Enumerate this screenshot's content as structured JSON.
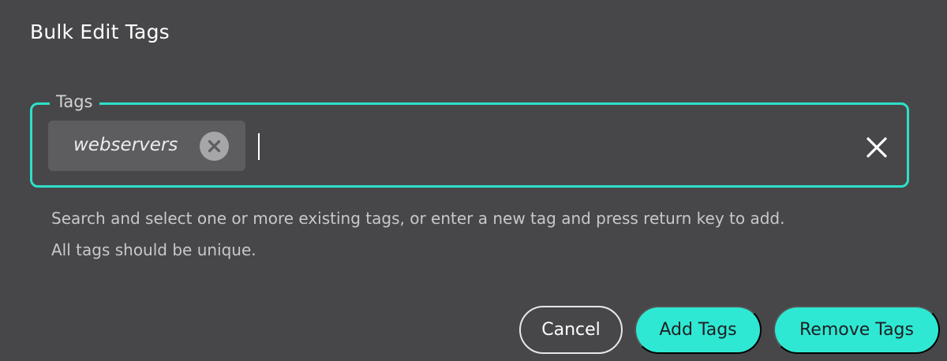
{
  "dialog": {
    "title": "Bulk Edit Tags"
  },
  "tags_field": {
    "legend": "Tags",
    "chips": [
      {
        "label": "webservers",
        "remove_icon": "x-circle-icon"
      }
    ],
    "input_value": "",
    "clear_icon": "close-icon",
    "accent_color": "#2de0c8"
  },
  "helper_text": {
    "line1": "Search and select one or more existing tags, or enter a new tag and press return key to add.",
    "line2": "All tags should be unique."
  },
  "actions": {
    "cancel_label": "Cancel",
    "add_label": "Add Tags",
    "remove_label": "Remove Tags",
    "primary_color": "#2ee8d3"
  }
}
